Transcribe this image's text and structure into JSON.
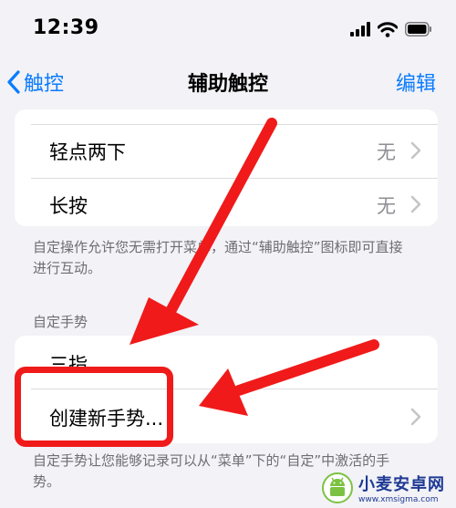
{
  "status_bar": {
    "time": "12:39"
  },
  "nav": {
    "back_label": "触控",
    "title": "辅助触控",
    "edit_label": "编辑"
  },
  "actions": {
    "rows": [
      {
        "label": "轻点两下",
        "value": "无"
      },
      {
        "label": "长按",
        "value": "无"
      }
    ],
    "footnote": "自定操作允许您无需打开菜单，通过“辅助触控”图标即可直接进行互动。"
  },
  "gestures": {
    "section_title": "自定手势",
    "rows": [
      {
        "label": "三指"
      },
      {
        "label": "创建新手势..."
      }
    ],
    "footnote": "自定手势让您能够记录可以从“菜单”下的“自定”中激活的手势。"
  },
  "watermark": {
    "brand": "小麦安卓网",
    "url": "www.xmsigma.com"
  },
  "colors": {
    "accent": "#0a7bff",
    "annotation_red": "#f01a1a",
    "background": "#f2f2f7"
  }
}
